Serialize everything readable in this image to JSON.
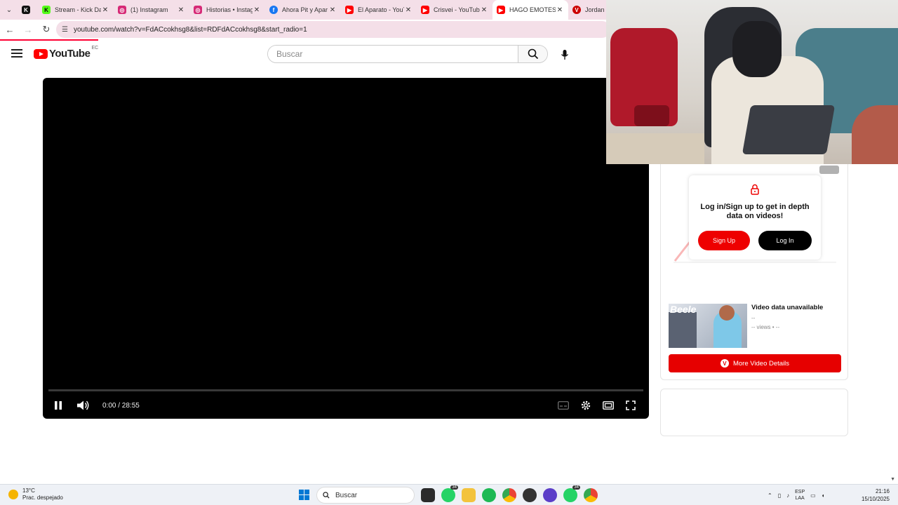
{
  "browser": {
    "tabs": [
      {
        "title": "",
        "icon": "kick-icon",
        "color": "#111111",
        "active": false
      },
      {
        "title": "Stream - Kick Da",
        "icon": "kick-icon",
        "color": "#53fc18",
        "active": false
      },
      {
        "title": "(1) Instagram",
        "icon": "instagram-icon",
        "color": "#d62976",
        "active": false
      },
      {
        "title": "Historias • Instag",
        "icon": "instagram-icon",
        "color": "#d62976",
        "active": false
      },
      {
        "title": "Ahora Pit y Apar",
        "icon": "facebook-icon",
        "color": "#1877f2",
        "active": false
      },
      {
        "title": "El Aparato - YouT",
        "icon": "youtube-icon",
        "color": "#ff0000",
        "active": false
      },
      {
        "title": "Crisvei - YouTub",
        "icon": "youtube-icon",
        "color": "#ff0000",
        "active": false
      },
      {
        "title": "HAGO EMOTES E",
        "icon": "youtube-icon",
        "color": "#ff0000",
        "active": true
      },
      {
        "title": "Jordan M",
        "icon": "vidiq-icon",
        "color": "#cc0000",
        "active": false
      }
    ],
    "url": "youtube.com/watch?v=FdACcokhsg8&list=RDFdACcokhsg8&start_radio=1"
  },
  "youtube": {
    "logo_text": "YouTube",
    "country_code": "EC",
    "search_placeholder": "Buscar"
  },
  "player": {
    "time": "0:00 / 28:55",
    "progress": 0
  },
  "sidebar": {
    "login_message": "Log in/Sign up to get in depth data on videos!",
    "signup_label": "Sign Up",
    "login_label": "Log In",
    "video_title": "Video data unavailable",
    "video_sub": "--",
    "video_views": "-- views • --",
    "thumb_caption": "Beele",
    "more_details_label": "More Video Details"
  },
  "taskbar": {
    "temperature": "13°C",
    "weather": "Prac. despejado",
    "search_label": "Buscar",
    "lang_top": "ESP",
    "lang_bottom": "LAA",
    "time": "21:16",
    "date": "15/10/2025",
    "badges": {
      "whatsapp": "34",
      "whatsapp2": "34"
    }
  },
  "colors": {
    "accent": "#ff0000",
    "chrome_tab_bar": "#f4dfe8",
    "more_button": "#e60000"
  }
}
